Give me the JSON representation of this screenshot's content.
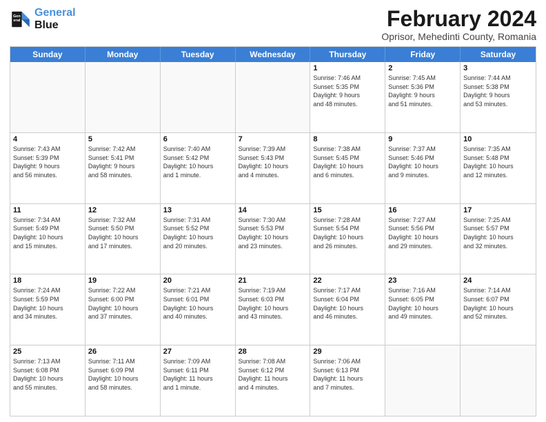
{
  "header": {
    "logo_line1": "General",
    "logo_line2": "Blue",
    "month_title": "February 2024",
    "location": "Oprisor, Mehedinti County, Romania"
  },
  "weekdays": [
    "Sunday",
    "Monday",
    "Tuesday",
    "Wednesday",
    "Thursday",
    "Friday",
    "Saturday"
  ],
  "rows": [
    [
      {
        "day": "",
        "info": ""
      },
      {
        "day": "",
        "info": ""
      },
      {
        "day": "",
        "info": ""
      },
      {
        "day": "",
        "info": ""
      },
      {
        "day": "1",
        "info": "Sunrise: 7:46 AM\nSunset: 5:35 PM\nDaylight: 9 hours\nand 48 minutes."
      },
      {
        "day": "2",
        "info": "Sunrise: 7:45 AM\nSunset: 5:36 PM\nDaylight: 9 hours\nand 51 minutes."
      },
      {
        "day": "3",
        "info": "Sunrise: 7:44 AM\nSunset: 5:38 PM\nDaylight: 9 hours\nand 53 minutes."
      }
    ],
    [
      {
        "day": "4",
        "info": "Sunrise: 7:43 AM\nSunset: 5:39 PM\nDaylight: 9 hours\nand 56 minutes."
      },
      {
        "day": "5",
        "info": "Sunrise: 7:42 AM\nSunset: 5:41 PM\nDaylight: 9 hours\nand 58 minutes."
      },
      {
        "day": "6",
        "info": "Sunrise: 7:40 AM\nSunset: 5:42 PM\nDaylight: 10 hours\nand 1 minute."
      },
      {
        "day": "7",
        "info": "Sunrise: 7:39 AM\nSunset: 5:43 PM\nDaylight: 10 hours\nand 4 minutes."
      },
      {
        "day": "8",
        "info": "Sunrise: 7:38 AM\nSunset: 5:45 PM\nDaylight: 10 hours\nand 6 minutes."
      },
      {
        "day": "9",
        "info": "Sunrise: 7:37 AM\nSunset: 5:46 PM\nDaylight: 10 hours\nand 9 minutes."
      },
      {
        "day": "10",
        "info": "Sunrise: 7:35 AM\nSunset: 5:48 PM\nDaylight: 10 hours\nand 12 minutes."
      }
    ],
    [
      {
        "day": "11",
        "info": "Sunrise: 7:34 AM\nSunset: 5:49 PM\nDaylight: 10 hours\nand 15 minutes."
      },
      {
        "day": "12",
        "info": "Sunrise: 7:32 AM\nSunset: 5:50 PM\nDaylight: 10 hours\nand 17 minutes."
      },
      {
        "day": "13",
        "info": "Sunrise: 7:31 AM\nSunset: 5:52 PM\nDaylight: 10 hours\nand 20 minutes."
      },
      {
        "day": "14",
        "info": "Sunrise: 7:30 AM\nSunset: 5:53 PM\nDaylight: 10 hours\nand 23 minutes."
      },
      {
        "day": "15",
        "info": "Sunrise: 7:28 AM\nSunset: 5:54 PM\nDaylight: 10 hours\nand 26 minutes."
      },
      {
        "day": "16",
        "info": "Sunrise: 7:27 AM\nSunset: 5:56 PM\nDaylight: 10 hours\nand 29 minutes."
      },
      {
        "day": "17",
        "info": "Sunrise: 7:25 AM\nSunset: 5:57 PM\nDaylight: 10 hours\nand 32 minutes."
      }
    ],
    [
      {
        "day": "18",
        "info": "Sunrise: 7:24 AM\nSunset: 5:59 PM\nDaylight: 10 hours\nand 34 minutes."
      },
      {
        "day": "19",
        "info": "Sunrise: 7:22 AM\nSunset: 6:00 PM\nDaylight: 10 hours\nand 37 minutes."
      },
      {
        "day": "20",
        "info": "Sunrise: 7:21 AM\nSunset: 6:01 PM\nDaylight: 10 hours\nand 40 minutes."
      },
      {
        "day": "21",
        "info": "Sunrise: 7:19 AM\nSunset: 6:03 PM\nDaylight: 10 hours\nand 43 minutes."
      },
      {
        "day": "22",
        "info": "Sunrise: 7:17 AM\nSunset: 6:04 PM\nDaylight: 10 hours\nand 46 minutes."
      },
      {
        "day": "23",
        "info": "Sunrise: 7:16 AM\nSunset: 6:05 PM\nDaylight: 10 hours\nand 49 minutes."
      },
      {
        "day": "24",
        "info": "Sunrise: 7:14 AM\nSunset: 6:07 PM\nDaylight: 10 hours\nand 52 minutes."
      }
    ],
    [
      {
        "day": "25",
        "info": "Sunrise: 7:13 AM\nSunset: 6:08 PM\nDaylight: 10 hours\nand 55 minutes."
      },
      {
        "day": "26",
        "info": "Sunrise: 7:11 AM\nSunset: 6:09 PM\nDaylight: 10 hours\nand 58 minutes."
      },
      {
        "day": "27",
        "info": "Sunrise: 7:09 AM\nSunset: 6:11 PM\nDaylight: 11 hours\nand 1 minute."
      },
      {
        "day": "28",
        "info": "Sunrise: 7:08 AM\nSunset: 6:12 PM\nDaylight: 11 hours\nand 4 minutes."
      },
      {
        "day": "29",
        "info": "Sunrise: 7:06 AM\nSunset: 6:13 PM\nDaylight: 11 hours\nand 7 minutes."
      },
      {
        "day": "",
        "info": ""
      },
      {
        "day": "",
        "info": ""
      }
    ]
  ]
}
